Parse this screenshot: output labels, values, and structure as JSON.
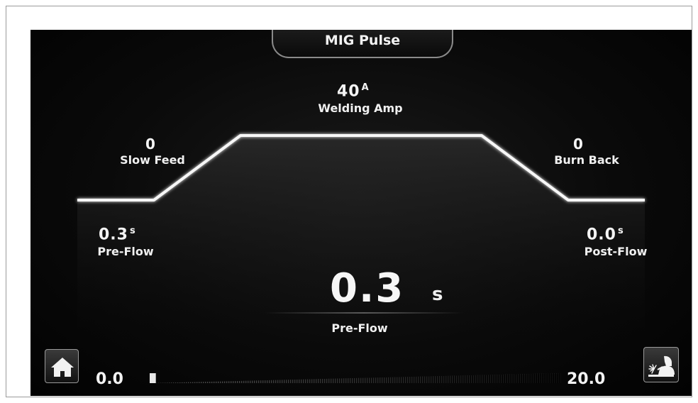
{
  "header": {
    "mode_title": "MIG Pulse"
  },
  "parameters": {
    "welding_amp": {
      "value": "40",
      "unit": "A",
      "label": "Welding Amp"
    },
    "slow_feed": {
      "value": "0",
      "label": "Slow Feed"
    },
    "burn_back": {
      "value": "0",
      "label": "Burn Back"
    },
    "pre_flow": {
      "value": "0.3",
      "unit": "s",
      "label": "Pre-Flow"
    },
    "post_flow": {
      "value": "0.0",
      "unit": "s",
      "label": "Post-Flow"
    }
  },
  "selected": {
    "value": "0.3",
    "unit": "s",
    "label": "Pre-Flow"
  },
  "range": {
    "min": "0.0",
    "max": "20.0",
    "fill_fraction": 0.015
  },
  "icons": {
    "home": "home-icon",
    "welder": "welder-icon"
  },
  "colors": {
    "background": "#050505",
    "line": "#f5f5f5",
    "text": "#f2f2f2"
  }
}
